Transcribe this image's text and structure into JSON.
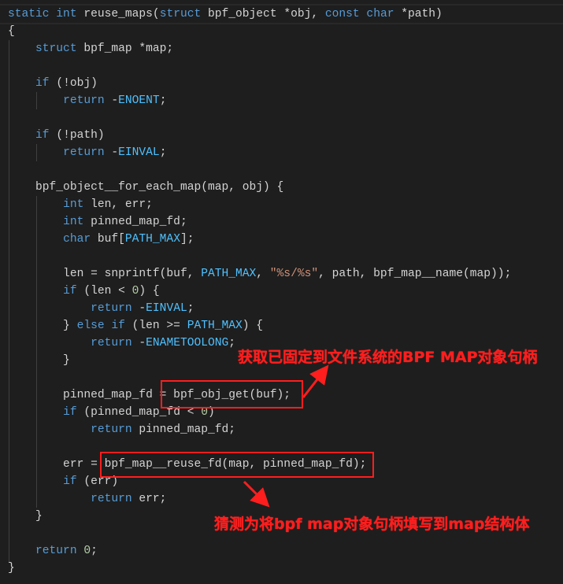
{
  "colors": {
    "background": "#1e1e1e",
    "keyword": "#569cd6",
    "macro": "#4fc1ff",
    "string": "#ce9178",
    "number": "#b5cea8",
    "text": "#d4d4d4",
    "annotation": "#ff1e1e"
  },
  "code_lines": [
    [
      [
        "kw",
        "static int "
      ],
      [
        "txt",
        "reuse_maps("
      ],
      [
        "kw",
        "struct "
      ],
      [
        "txt",
        "bpf_object *obj, "
      ],
      [
        "kw",
        "const char "
      ],
      [
        "txt",
        "*path)"
      ]
    ],
    [
      [
        "txt",
        "{"
      ]
    ],
    [
      [
        "txt",
        "    "
      ],
      [
        "kw",
        "struct "
      ],
      [
        "txt",
        "bpf_map *map;"
      ]
    ],
    [],
    [
      [
        "txt",
        "    "
      ],
      [
        "kw",
        "if "
      ],
      [
        "txt",
        "(!obj)"
      ]
    ],
    [
      [
        "txt",
        "        "
      ],
      [
        "kw",
        "return "
      ],
      [
        "txt",
        "-"
      ],
      [
        "mac",
        "ENOENT"
      ],
      [
        "txt",
        ";"
      ]
    ],
    [],
    [
      [
        "txt",
        "    "
      ],
      [
        "kw",
        "if "
      ],
      [
        "txt",
        "(!path)"
      ]
    ],
    [
      [
        "txt",
        "        "
      ],
      [
        "kw",
        "return "
      ],
      [
        "txt",
        "-"
      ],
      [
        "mac",
        "EINVAL"
      ],
      [
        "txt",
        ";"
      ]
    ],
    [],
    [
      [
        "txt",
        "    bpf_object__for_each_map(map, obj) {"
      ]
    ],
    [
      [
        "txt",
        "        "
      ],
      [
        "kw",
        "int "
      ],
      [
        "txt",
        "len, err;"
      ]
    ],
    [
      [
        "txt",
        "        "
      ],
      [
        "kw",
        "int "
      ],
      [
        "txt",
        "pinned_map_fd;"
      ]
    ],
    [
      [
        "txt",
        "        "
      ],
      [
        "kw",
        "char "
      ],
      [
        "txt",
        "buf["
      ],
      [
        "mac",
        "PATH_MAX"
      ],
      [
        "txt",
        "];"
      ]
    ],
    [],
    [
      [
        "txt",
        "        len = snprintf(buf, "
      ],
      [
        "mac",
        "PATH_MAX"
      ],
      [
        "txt",
        ", "
      ],
      [
        "str",
        "\"%s/%s\""
      ],
      [
        "txt",
        ", path, bpf_map__name(map));"
      ]
    ],
    [
      [
        "txt",
        "        "
      ],
      [
        "kw",
        "if "
      ],
      [
        "txt",
        "(len < "
      ],
      [
        "num",
        "0"
      ],
      [
        "txt",
        ") {"
      ]
    ],
    [
      [
        "txt",
        "            "
      ],
      [
        "kw",
        "return "
      ],
      [
        "txt",
        "-"
      ],
      [
        "mac",
        "EINVAL"
      ],
      [
        "txt",
        ";"
      ]
    ],
    [
      [
        "txt",
        "        } "
      ],
      [
        "kw",
        "else if "
      ],
      [
        "txt",
        "(len >= "
      ],
      [
        "mac",
        "PATH_MAX"
      ],
      [
        "txt",
        ") {"
      ]
    ],
    [
      [
        "txt",
        "            "
      ],
      [
        "kw",
        "return "
      ],
      [
        "txt",
        "-"
      ],
      [
        "mac",
        "ENAMETOOLONG"
      ],
      [
        "txt",
        ";"
      ]
    ],
    [
      [
        "txt",
        "        }"
      ]
    ],
    [],
    [
      [
        "txt",
        "        pinned_map_fd = bpf_obj_get(buf);"
      ]
    ],
    [
      [
        "txt",
        "        "
      ],
      [
        "kw",
        "if "
      ],
      [
        "txt",
        "(pinned_map_fd < "
      ],
      [
        "num",
        "0"
      ],
      [
        "txt",
        ")"
      ]
    ],
    [
      [
        "txt",
        "            "
      ],
      [
        "kw",
        "return "
      ],
      [
        "txt",
        "pinned_map_fd;"
      ]
    ],
    [],
    [
      [
        "txt",
        "        err = bpf_map__reuse_fd(map, pinned_map_fd);"
      ]
    ],
    [
      [
        "txt",
        "        "
      ],
      [
        "kw",
        "if "
      ],
      [
        "txt",
        "(err)"
      ]
    ],
    [
      [
        "txt",
        "            "
      ],
      [
        "kw",
        "return "
      ],
      [
        "txt",
        "err;"
      ]
    ],
    [
      [
        "txt",
        "    }"
      ]
    ],
    [],
    [
      [
        "txt",
        "    "
      ],
      [
        "kw",
        "return "
      ],
      [
        "num",
        "0"
      ],
      [
        "txt",
        ";"
      ]
    ],
    [
      [
        "txt",
        "}"
      ]
    ]
  ],
  "annotations": [
    {
      "text": "获取已固定到文件系统的BPF MAP对象句柄"
    },
    {
      "text": "猜测为将bpf map对象句柄填写到map结构体"
    }
  ]
}
